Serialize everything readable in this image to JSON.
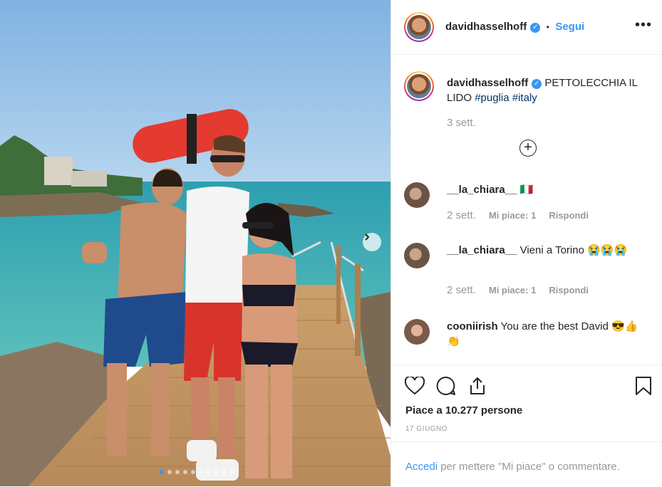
{
  "post": {
    "carousel": {
      "total_slides": 10,
      "active_slide": 1
    }
  },
  "header": {
    "username": "davidhasselhoff",
    "separator": "•",
    "follow_label": "Segui",
    "more_label": "•••"
  },
  "caption": {
    "username": "davidhasselhoff",
    "text": "PETTOLECCHIA IL LIDO",
    "hashtags": [
      "#puglia",
      "#italy"
    ],
    "time": "3 sett."
  },
  "load_more_label": "+",
  "comments": [
    {
      "username": "__la_chiara__",
      "text": "🇮🇹",
      "time": "2 sett.",
      "likes": "Mi piace: 1",
      "reply": "Rispondi"
    },
    {
      "username": "__la_chiara__",
      "text": "Vieni a Torino 😭😭😭",
      "time": "2 sett.",
      "likes": "Mi piace: 1",
      "reply": "Rispondi"
    },
    {
      "username": "cooniirish",
      "text": "You are the best David 😎👍👏"
    }
  ],
  "actions": {
    "likes_text": "Piace a 10.277 persone",
    "date": "17 GIUGNO"
  },
  "login_prompt": {
    "link": "Accedi",
    "rest": " per mettere \"Mi piace\" o commentare."
  },
  "colors": {
    "accent": "#3897f0",
    "text": "#262626",
    "muted": "#999999",
    "hashtag": "#003569"
  }
}
